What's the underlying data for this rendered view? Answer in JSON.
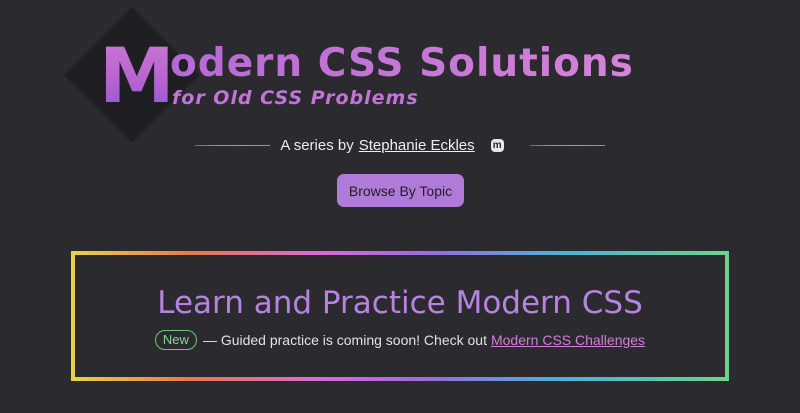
{
  "header": {
    "logo_initial": "M",
    "logo_title_rest": "odern CSS Solutions",
    "logo_subtitle": "for Old CSS Problems"
  },
  "byline": {
    "prefix": "A series by",
    "author": "Stephanie Eckles",
    "social_icon": "mastodon-icon",
    "social_glyph": "m"
  },
  "browse_button": {
    "label": "Browse By Topic"
  },
  "promo": {
    "title": "Learn and Practice Modern CSS",
    "badge": "New",
    "text": "— Guided practice is coming soon! Check out",
    "link": "Modern CSS Challenges"
  },
  "colors": {
    "background": "#2b2a2e",
    "accent": "#b07bd8",
    "badge_green": "#68c77c",
    "link_pink": "#d07ed8"
  }
}
